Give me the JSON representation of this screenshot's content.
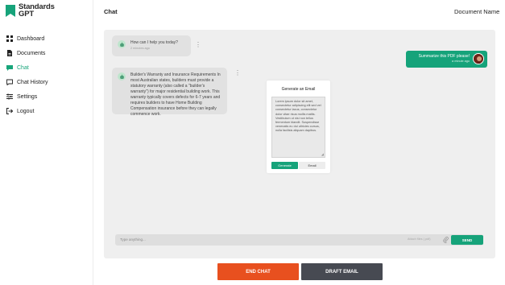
{
  "app": {
    "logo_line1": "Standards",
    "logo_line2": "GPT"
  },
  "sidebar": {
    "items": [
      {
        "label": "Dashboard",
        "icon": "grid-icon"
      },
      {
        "label": "Documents",
        "icon": "document-icon"
      },
      {
        "label": "Chat",
        "icon": "chat-icon",
        "active": true
      },
      {
        "label": "Chat History",
        "icon": "chat-history-icon"
      },
      {
        "label": "Settings",
        "icon": "settings-icon"
      },
      {
        "label": "Logout",
        "icon": "logout-icon"
      }
    ]
  },
  "header": {
    "title": "Chat",
    "document_name": "Document Name"
  },
  "chat": {
    "bot_greeting": {
      "text": "How can I help you today?",
      "time": "2 minutes ago"
    },
    "user_message": {
      "text": "Summarize this PDF please!",
      "time": "a minute ago"
    },
    "bot_answer": {
      "text": "Builder's Warranty and Insurance Requirements In most Australian states, builders must provide a statutory warranty (also called a \"builder's warranty\") for major residential building work. This warranty typically covers defects for 6-7 years and requires builders to have Home Building Compensation insurance before they can legally commence work."
    }
  },
  "email_card": {
    "title": "Generate an Email",
    "body": "Lorem ipsum dolor sit amet, consectetur adipiscing elit sed vel consectetur lacus, consectetur dolor vitae risus mollis mattis. Vestibulum ut nisi non tellus fermentum blandit. Suspendisse venenatis eu dui ultricies cursus, nulla facilisis aliquam dapibus.",
    "generate_label": "Generate",
    "email_label": "Email"
  },
  "input": {
    "placeholder": "Type anything...",
    "attach_label": "Attach files (.pdf)",
    "send_label": "SEND"
  },
  "actions": {
    "end_chat": "END CHAT",
    "draft_email": "DRAFT EMAIL"
  },
  "colors": {
    "accent": "#16a37a",
    "end_chat": "#e8501f",
    "draft_email": "#474a52"
  }
}
